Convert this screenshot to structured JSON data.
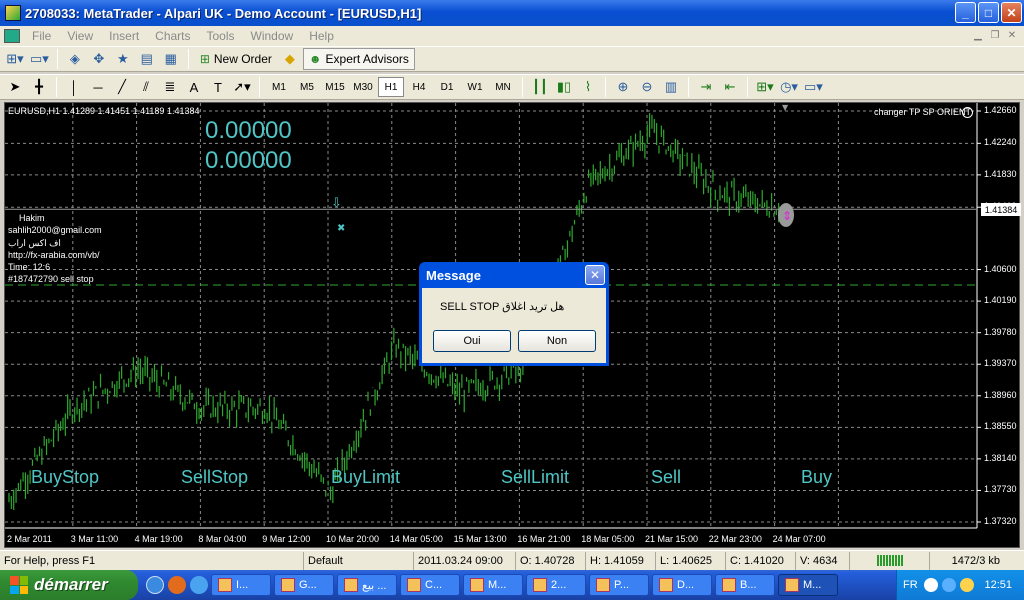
{
  "window": {
    "title": "2708033: MetaTrader - Alpari UK - Demo Account - [EURUSD,H1]",
    "minimize": "_",
    "maximize": "□",
    "close": "✕"
  },
  "menu": [
    "File",
    "View",
    "Insert",
    "Charts",
    "Tools",
    "Window",
    "Help"
  ],
  "toolbar": {
    "new_order": "New Order",
    "expert_advisors": "Expert Advisors",
    "timeframes": [
      "M1",
      "M5",
      "M15",
      "M30",
      "H1",
      "H4",
      "D1",
      "W1",
      "MN"
    ],
    "active_timeframe": "H1"
  },
  "chart": {
    "symbol_header": "EURUSD,H1  1.41289 1.41451 1.41189 1.41384",
    "value_1": "0.00000",
    "value_2": "0.00000",
    "info_lines": [
      "Hakim",
      "sahlih2000@gmail.com",
      "اف اكس اراب",
      "http://fx-arabia.com/vb/",
      "Time: 12:6",
      "#187472790 sell stop"
    ],
    "ea_name": "changer TP SP ORIENT",
    "current_price": "1.41384",
    "buttons": [
      "BuyStop",
      "SellStop",
      "BuyLimit",
      "SellLimit",
      "Sell",
      "Buy"
    ],
    "y_ticks": [
      "1.42660",
      "1.42240",
      "1.41830",
      "1.41410",
      "1.40600",
      "1.40190",
      "1.39780",
      "1.39370",
      "1.38960",
      "1.38550",
      "1.38140",
      "1.37730",
      "1.37320"
    ],
    "x_ticks": [
      "2 Mar 2011",
      "3 Mar 11:00",
      "4 Mar 19:00",
      "8 Mar 04:00",
      "9 Mar 12:00",
      "10 Mar 20:00",
      "14 Mar 05:00",
      "15 Mar 13:00",
      "16 Mar 21:00",
      "18 Mar 05:00",
      "21 Mar 15:00",
      "22 Mar 23:00",
      "24 Mar 07:00"
    ]
  },
  "chart_data": {
    "type": "candlestick",
    "symbol": "EURUSD",
    "timeframe": "H1",
    "ylim": [
      1.3732,
      1.4266
    ],
    "ohlc_header": {
      "open": 1.41289,
      "high": 1.41451,
      "low": 1.41189,
      "close": 1.41384
    },
    "approx_close_path": [
      {
        "x": "2 Mar 2011",
        "y": 1.376
      },
      {
        "x": "3 Mar 11:00",
        "y": 1.388
      },
      {
        "x": "4 Mar 19:00",
        "y": 1.393
      },
      {
        "x": "8 Mar 04:00",
        "y": 1.388
      },
      {
        "x": "9 Mar 12:00",
        "y": 1.388
      },
      {
        "x": "10 Mar 20:00",
        "y": 1.377
      },
      {
        "x": "14 Mar 05:00",
        "y": 1.396
      },
      {
        "x": "15 Mar 13:00",
        "y": 1.39
      },
      {
        "x": "16 Mar 21:00",
        "y": 1.393
      },
      {
        "x": "18 Mar 05:00",
        "y": 1.417
      },
      {
        "x": "21 Mar 15:00",
        "y": 1.424
      },
      {
        "x": "22 Mar 23:00",
        "y": 1.416
      },
      {
        "x": "24 Mar 07:00",
        "y": 1.4138
      }
    ],
    "current_price": 1.41384,
    "pending_order_level": 1.404
  },
  "dialog": {
    "title": "Message",
    "close": "✕",
    "message": "SELL STOP  هل تريد اغلاق",
    "yes": "Oui",
    "no": "Non"
  },
  "status": {
    "help": "For Help, press F1",
    "profile": "Default",
    "datetime": "2011.03.24 09:00",
    "open": "O: 1.40728",
    "high": "H: 1.41059",
    "low": "L: 1.40625",
    "close": "C: 1.41020",
    "volume": "V: 4634",
    "traffic": "1472/3 kb"
  },
  "taskbar": {
    "start": "démarrer",
    "items": [
      "I...",
      "G...",
      "بيع ...",
      "C...",
      "M...",
      "2...",
      "P...",
      "D...",
      "B...",
      "M..."
    ],
    "lang": "FR",
    "clock": "12:51"
  }
}
